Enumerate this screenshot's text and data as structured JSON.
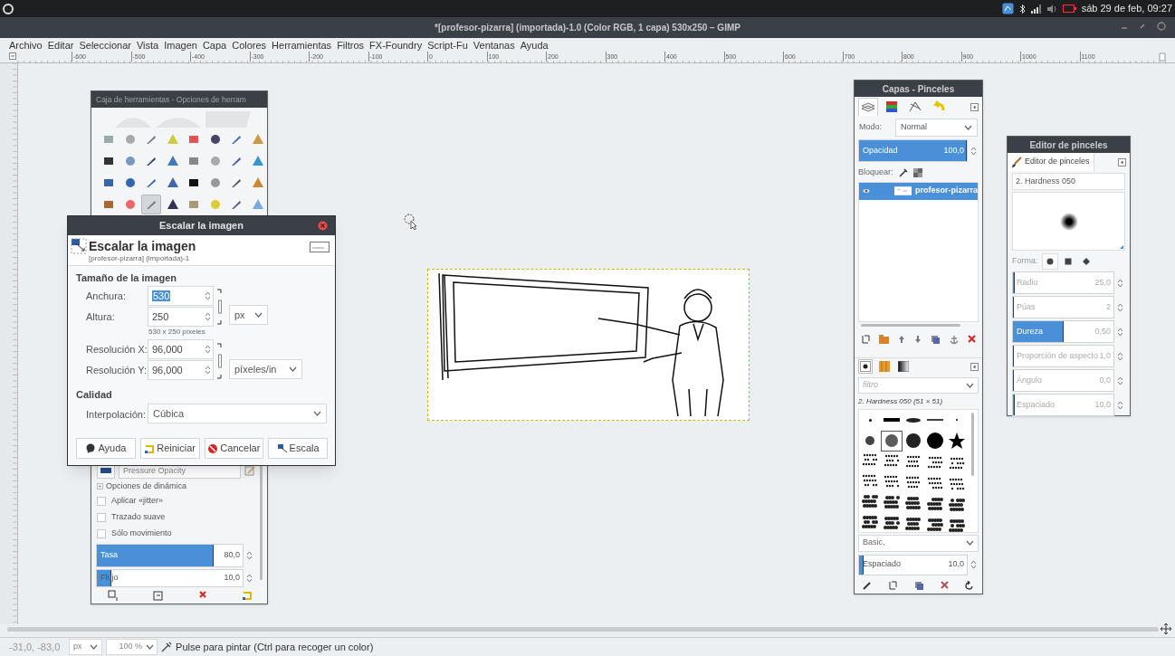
{
  "system_bar": {
    "clock": "sáb 29 de feb, 09:27"
  },
  "window": {
    "title": "*[profesor-pizarra] (importada)-1.0 (Color RGB, 1 capa) 530x250 – GIMP"
  },
  "menu": [
    "Archivo",
    "Editar",
    "Seleccionar",
    "Vista",
    "Imagen",
    "Capa",
    "Colores",
    "Herramientas",
    "Filtros",
    "FX-Foundry",
    "Script-Fu",
    "Ventanas",
    "Ayuda"
  ],
  "ruler_labels": [
    "-600",
    "-500",
    "-400",
    "-300",
    "-200",
    "-100",
    "0",
    "100",
    "200",
    "300",
    "400",
    "500",
    "600",
    "700",
    "800",
    "900",
    "1000",
    "1100"
  ],
  "toolbox": {
    "title": "Caja de herramientas - Opciones de herram",
    "tools": [
      {
        "selected": false
      },
      {
        "selected": false
      },
      {
        "selected": false
      },
      {
        "selected": false
      },
      {
        "selected": false
      },
      {
        "selected": false
      },
      {
        "selected": false
      },
      {
        "selected": false
      },
      {
        "selected": false
      },
      {
        "selected": false
      },
      {
        "selected": false
      },
      {
        "selected": false
      },
      {
        "selected": false
      },
      {
        "selected": false
      },
      {
        "selected": false
      },
      {
        "selected": false
      },
      {
        "selected": false
      },
      {
        "selected": false
      },
      {
        "selected": false
      },
      {
        "selected": false
      },
      {
        "selected": false
      },
      {
        "selected": false
      },
      {
        "selected": false
      },
      {
        "selected": false
      },
      {
        "selected": false
      },
      {
        "selected": false
      },
      {
        "selected": true
      },
      {
        "selected": false
      },
      {
        "selected": false
      },
      {
        "selected": false
      },
      {
        "selected": false
      },
      {
        "selected": false
      }
    ],
    "dynamics": "Pressure Opacity",
    "dynamics_options": "Opciones de dinámica",
    "checkboxes": [
      {
        "label": "Aplicar «jitter»",
        "checked": false
      },
      {
        "label": "Trazado suave",
        "checked": false
      },
      {
        "label": "Sólo movimiento",
        "checked": false
      }
    ],
    "sliders": [
      {
        "label": "Tasa",
        "value": "80,0",
        "level": 0.8
      },
      {
        "label": "Flujo",
        "value": "10,0",
        "level": 0.1
      }
    ]
  },
  "scale_dialog": {
    "title": "Escalar la imagen",
    "heading": "Escalar la imagen",
    "subtitle": "[profesor-pizarra] (importada)-1",
    "size_section": "Tamaño de la imagen",
    "size_fields": [
      {
        "label": "Anchura:",
        "value": "530",
        "selected": true
      },
      {
        "label": "Altura:",
        "value": "250",
        "selected": false
      }
    ],
    "size_unit": "px",
    "size_note": "530 x 250 píxeles",
    "resolution_fields": [
      {
        "label": "Resolución X:",
        "value": "96,000",
        "selected": false
      },
      {
        "label": "Resolución Y:",
        "value": "96,000",
        "selected": false
      }
    ],
    "resolution_unit": "píxeles/in",
    "quality_section": "Calidad",
    "interpolation_label": "Interpolación:",
    "interpolation": "Cúbica",
    "buttons": [
      "Ayuda",
      "Reiniciar",
      "Cancelar",
      "Escala"
    ]
  },
  "layers_dock": {
    "title": "Capas - Pinceles",
    "tabs": [
      {
        "selected": true
      },
      {
        "selected": false
      },
      {
        "selected": false
      },
      {
        "selected": false
      }
    ],
    "mode_label": "Modo:",
    "mode": "Normal",
    "opacity": {
      "label": "Opacidad",
      "value": "100,0",
      "level": 1
    },
    "lock_label": "Bloquear:",
    "layers": [
      {
        "name": "profesor-pizarra",
        "selected": true
      }
    ],
    "brush_tabs": [
      {
        "selected": true
      },
      {
        "selected": false
      },
      {
        "selected": false
      }
    ],
    "filter_placeholder": "filtro",
    "brush_name": "2. Hardness 050 (51 × 51)",
    "brushes": [
      {
        "selected": false
      },
      {
        "selected": false
      },
      {
        "selected": false
      },
      {
        "selected": false
      },
      {
        "selected": false
      },
      {
        "selected": false
      },
      {
        "selected": true
      },
      {
        "selected": false
      },
      {
        "selected": false
      },
      {
        "selected": false
      },
      {
        "selected": false
      },
      {
        "selected": false
      },
      {
        "selected": false
      },
      {
        "selected": false
      },
      {
        "selected": false
      },
      {
        "selected": false
      },
      {
        "selected": false
      },
      {
        "selected": false
      },
      {
        "selected": false
      },
      {
        "selected": false
      },
      {
        "selected": false
      },
      {
        "selected": false
      },
      {
        "selected": false
      },
      {
        "selected": false
      },
      {
        "selected": false
      },
      {
        "selected": false
      },
      {
        "selected": false
      },
      {
        "selected": false
      },
      {
        "selected": false
      },
      {
        "selected": false
      }
    ],
    "tag": "Basic,",
    "spacing": {
      "label": "Espaciado",
      "value": "10,0",
      "level": 0.04
    }
  },
  "brush_editor": {
    "title": "Editor de pinceles",
    "tab": "Editor de pinceles",
    "brush_name": "2. Hardness 050",
    "shape_label": "Forma:",
    "shapes": [
      {
        "kind": "circle",
        "selected": true
      },
      {
        "kind": "square",
        "selected": false
      },
      {
        "kind": "diamond",
        "selected": false
      }
    ],
    "params": [
      {
        "label": "Radio",
        "value": "25,0",
        "level": 0.02
      },
      {
        "label": "Púas",
        "value": "2",
        "level": 0
      },
      {
        "label": "Dureza",
        "value": "0,50",
        "level": 0.5
      },
      {
        "label": "Proporción de aspecto",
        "value": "1,0",
        "level": 0
      },
      {
        "label": "Ángulo",
        "value": "0,0",
        "level": 0
      },
      {
        "label": "Espaciado",
        "value": "10,0",
        "level": 0.02
      }
    ]
  },
  "status_bar": {
    "coords": "-31,0, -83,0",
    "unit": "px",
    "zoom": "100 %",
    "message": "Pulse para pintar (Ctrl para recoger un color)"
  }
}
